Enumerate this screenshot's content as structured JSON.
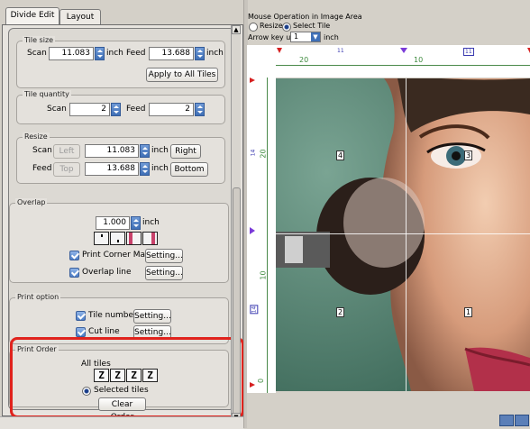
{
  "tabs": {
    "divide_edit": "Divide Edit",
    "layout": "Layout"
  },
  "tile_size": {
    "caption": "Tile size",
    "scan_label": "Scan",
    "scan_value": "11.083",
    "scan_unit": "inch",
    "feed_label": "Feed",
    "feed_value": "13.688",
    "feed_unit": "inch",
    "apply_button": "Apply to All Tiles"
  },
  "tile_quantity": {
    "caption": "Tile quantity",
    "scan_label": "Scan",
    "scan_value": "2",
    "feed_label": "Feed",
    "feed_value": "2"
  },
  "resize": {
    "caption": "Resize",
    "scan_label": "Scan",
    "left_button": "Left",
    "scan_value": "11.083",
    "scan_unit": "inch",
    "right_button": "Right",
    "feed_label": "Feed",
    "top_button": "Top",
    "feed_value": "13.688",
    "feed_unit": "inch",
    "bottom_button": "Bottom"
  },
  "overlap": {
    "caption": "Overlap",
    "value": "1.000",
    "unit": "inch",
    "print_corner_mark_label": "Print Corner Mark",
    "print_corner_mark_checked": true,
    "overlap_line_label": "Overlap line",
    "overlap_line_checked": true,
    "setting_label": "Setting..."
  },
  "print_option": {
    "caption": "Print option",
    "tile_number_label": "Tile number",
    "tile_number_checked": true,
    "cut_line_label": "Cut line",
    "cut_line_checked": true,
    "setting_label": "Setting..."
  },
  "print_order": {
    "caption": "Print Order",
    "all_tiles_label": "All tiles",
    "order_icons": [
      "Z",
      "Z",
      "Z",
      "Z"
    ],
    "selected_tiles_label": "Selected tiles",
    "clear_order_button": "Clear Order"
  },
  "mouse_operation": {
    "title": "Mouse Operation in Image Area",
    "resize_label": "Resize",
    "select_tile_label": "Select Tile",
    "selected": "Select Tile",
    "arrow_key_label": "Arrow key unit",
    "arrow_key_value": "1",
    "arrow_key_unit": "inch"
  },
  "ruler": {
    "top_labels": [
      "20",
      "10"
    ],
    "top_markers": [
      "11",
      "11"
    ],
    "left_labels": [
      "20",
      "14",
      "10",
      "14",
      "0"
    ]
  },
  "tiles": [
    {
      "number": "4"
    },
    {
      "number": "3"
    },
    {
      "number": "2"
    },
    {
      "number": "1"
    }
  ],
  "colors": {
    "highlight": "#e0231d",
    "accent": "#3f6fb6"
  }
}
